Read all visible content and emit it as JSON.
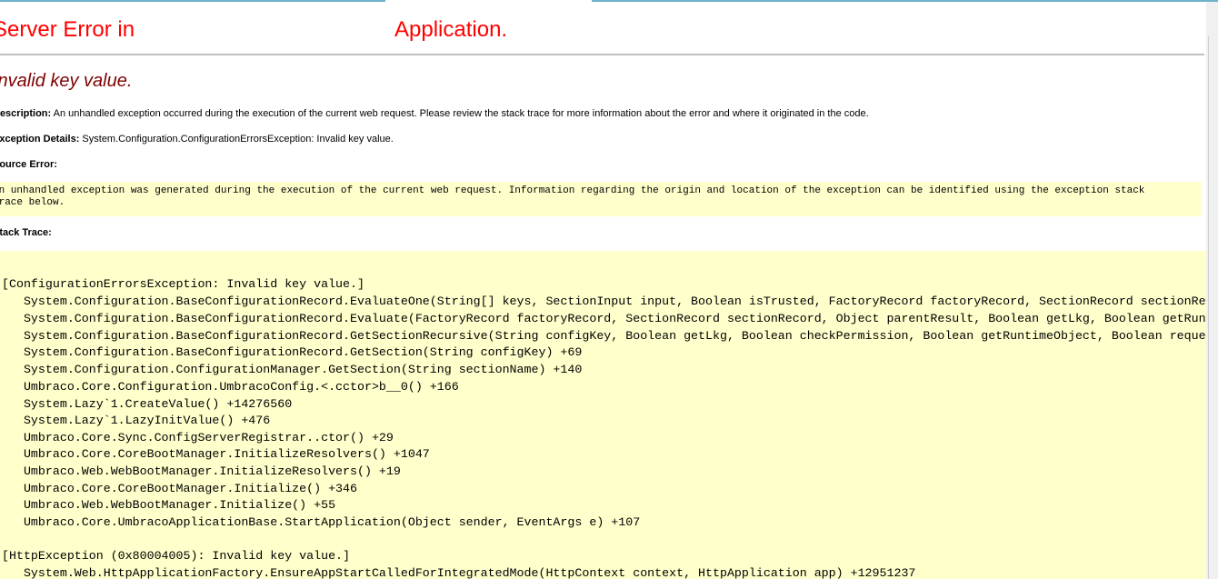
{
  "heading": {
    "part1": "Server Error in",
    "part2": "Application."
  },
  "error_title": "Invalid key value.",
  "description": {
    "label": "Description:",
    "text": "An unhandled exception occurred during the execution of the current web request. Please review the stack trace for more information about the error and where it originated in the code."
  },
  "exception_details": {
    "label": "Exception Details:",
    "text": "System.Configuration.ConfigurationErrorsException: Invalid key value."
  },
  "source_error": {
    "label": "Source Error:",
    "lines": [
      "An unhandled exception was generated during the execution of the current web request. Information regarding the origin and location of the exception can be identified using the exception stack",
      "trace below."
    ]
  },
  "stack_trace": {
    "label": "Stack Trace:",
    "lines": [
      "[ConfigurationErrorsException: Invalid key value.]",
      "   System.Configuration.BaseConfigurationRecord.EvaluateOne(String[] keys, SectionInput input, Boolean isTrusted, FactoryRecord factoryRecord, SectionRecord sectionRecord",
      "   System.Configuration.BaseConfigurationRecord.Evaluate(FactoryRecord factoryRecord, SectionRecord sectionRecord, Object parentResult, Boolean getLkg, Boolean getRuntime",
      "   System.Configuration.BaseConfigurationRecord.GetSectionRecursive(String configKey, Boolean getLkg, Boolean checkPermission, Boolean getRuntimeObject, Boolean requestIsH",
      "   System.Configuration.BaseConfigurationRecord.GetSection(String configKey) +69",
      "   System.Configuration.ConfigurationManager.GetSection(String sectionName) +140",
      "   Umbraco.Core.Configuration.UmbracoConfig.<.cctor>b__0() +166",
      "   System.Lazy`1.CreateValue() +14276560",
      "   System.Lazy`1.LazyInitValue() +476",
      "   Umbraco.Core.Sync.ConfigServerRegistrar..ctor() +29",
      "   Umbraco.Core.CoreBootManager.InitializeResolvers() +1047",
      "   Umbraco.Web.WebBootManager.InitializeResolvers() +19",
      "   Umbraco.Core.CoreBootManager.Initialize() +346",
      "   Umbraco.Web.WebBootManager.Initialize() +55",
      "   Umbraco.Core.UmbracoApplicationBase.StartApplication(Object sender, EventArgs e) +107",
      "",
      "[HttpException (0x80004005): Invalid key value.]",
      "   System.Web.HttpApplicationFactory.EnsureAppStartCalledForIntegratedMode(HttpContext context, HttpApplication app) +12951237"
    ]
  },
  "colors": {
    "heading": "#ff0000",
    "error_title": "#800000",
    "code_background": "#ffffcc",
    "rule": "#c0c0c0"
  }
}
